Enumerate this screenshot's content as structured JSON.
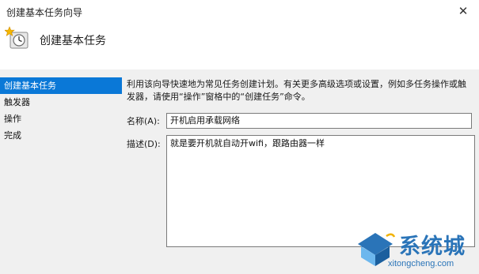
{
  "window": {
    "title": "创建基本任务向导",
    "close_glyph": "✕"
  },
  "header": {
    "icon": "task-clock-icon",
    "heading": "创建基本任务"
  },
  "sidebar": {
    "items": [
      {
        "label": "创建基本任务",
        "active": true
      },
      {
        "label": "触发器",
        "active": false
      },
      {
        "label": "操作",
        "active": false
      },
      {
        "label": "完成",
        "active": false
      }
    ]
  },
  "content": {
    "description": "利用该向导快速地为常见任务创建计划。有关更多高级选项或设置，例如多任务操作或触发器，请使用“操作”窗格中的“创建任务”命令。",
    "name_label": "名称(A):",
    "name_value": "开机启用承载网络",
    "desc_label": "描述(D):",
    "desc_value": "就是要开机就自动开wifi，跟路由器一样"
  },
  "watermark": {
    "text_cn": "系统城",
    "text_en": "xitongcheng.com"
  },
  "colors": {
    "accent": "#0a78d7",
    "body_bg": "#f0f0f0",
    "watermark_blue": "#2a74b8"
  }
}
